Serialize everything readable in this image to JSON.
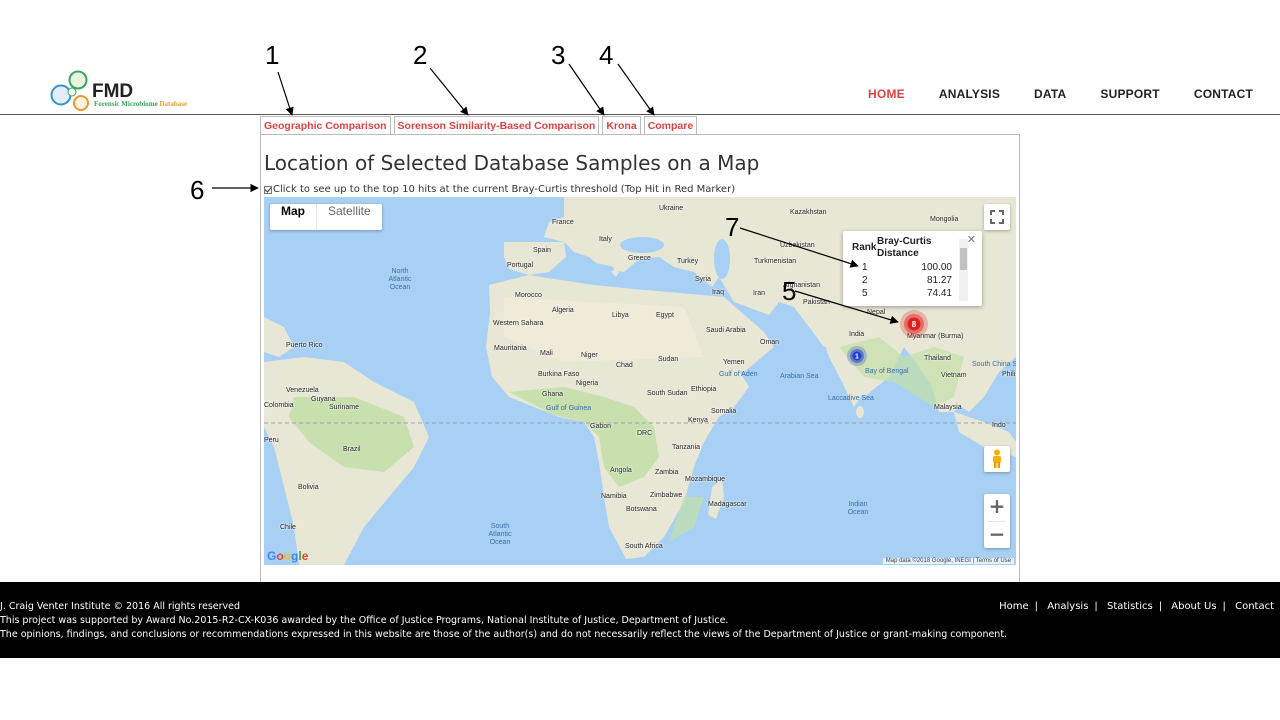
{
  "logo": {
    "title": "FMD",
    "subtitle_a": "Forensic Microbiome ",
    "subtitle_b": "Database"
  },
  "nav": [
    {
      "label": "HOME",
      "active": true
    },
    {
      "label": "ANALYSIS"
    },
    {
      "label": "DATA"
    },
    {
      "label": "SUPPORT"
    },
    {
      "label": "CONTACT"
    }
  ],
  "tabs": [
    "Geographic Comparison",
    "Sorenson Similarity-Based Comparison",
    "Krona",
    "Compare"
  ],
  "page_title": "Location of Selected Database Samples on a Map",
  "checkbox_label": "Click to see up to the top 10 hits at the current Bray-Curtis threshold (Top Hit in Red Marker)",
  "map": {
    "type_map": "Map",
    "type_satellite": "Satellite",
    "attribution": "Map data ©2018 Google, INEGI  |  Terms of Use",
    "labels": {
      "kazakhstan": "Kazakhstan",
      "mongolia": "Mongolia",
      "france": "France",
      "ukraine": "Ukraine",
      "spain": "Spain",
      "italy": "Italy",
      "portugal": "Portugal",
      "greece": "Greece",
      "turkey": "Turkey",
      "uzbekistan": "Uzbekistan",
      "turkmenistan": "Turkmenistan",
      "syria": "Syria",
      "iraq": "Iraq",
      "iran": "Iran",
      "afghanistan": "Afghanistan",
      "pakistan": "Pakistan",
      "nepal": "Nepal",
      "morocco": "Morocco",
      "algeria": "Algeria",
      "libya": "Libya",
      "egypt": "Egypt",
      "saudi": "Saudi Arabia",
      "oman": "Oman",
      "india": "India",
      "myanmar": "Myanmar (Burma)",
      "thailand": "Thailand",
      "vietnam": "Vietnam",
      "phili": "Phili",
      "scs": "South China Sea",
      "western_sahara": "Western Sahara",
      "mauritania": "Mauritania",
      "mali": "Mali",
      "niger": "Niger",
      "chad": "Chad",
      "sudan": "Sudan",
      "yemen": "Yemen",
      "gulf_aden": "Gulf of Aden",
      "arabian_sea": "Arabian Sea",
      "bay_bengal": "Bay of Bengal",
      "malaysia": "Malaysia",
      "burkina": "Burkina Faso",
      "nigeria": "Nigeria",
      "ghana": "Ghana",
      "south_sudan": "South Sudan",
      "ethiopia": "Ethiopia",
      "somalia": "Somalia",
      "gulf_guinea": "Gulf of Guinea",
      "gabon": "Gabon",
      "drc": "DRC",
      "kenya": "Kenya",
      "tanzania": "Tanzania",
      "laccadive": "Laccadive Sea",
      "puerto_rico": "Puerto Rico",
      "venezuela": "Venezuela",
      "colombia": "Colombia",
      "guyana": "Guyana",
      "suriname": "Suriname",
      "peru": "Peru",
      "brazil": "Brazil",
      "bolivia": "Bolivia",
      "chile": "Chile",
      "angola": "Angola",
      "zambia": "Zambia",
      "namibia": "Namibia",
      "zimbabwe": "Zimbabwe",
      "mozambique": "Mozambique",
      "botswana": "Botswana",
      "madagascar": "Madagascar",
      "south_africa": "South Africa",
      "indian_ocean": "Indian Ocean",
      "north_atlantic": "North Atlantic Ocean",
      "south_atlantic": "South Atlantic Ocean",
      "indonesia": "Indo"
    },
    "markers": [
      {
        "label": "8",
        "color": "#e02020"
      },
      {
        "label": "1",
        "color": "#2040d0"
      }
    ],
    "info": {
      "rank_header": "Rank",
      "distance_header": "Bray-Curtis Distance",
      "rows": [
        {
          "rank": "1",
          "value": "100.00"
        },
        {
          "rank": "2",
          "value": "81.27"
        },
        {
          "rank": "5",
          "value": "74.41"
        }
      ]
    }
  },
  "annotations": [
    "1",
    "2",
    "3",
    "4",
    "5",
    "6",
    "7"
  ],
  "footer": {
    "line1": "J. Craig Venter Institute © 2016 All rights reserved",
    "line2": "This project was supported by Award No.2015-R2-CX-K036 awarded by the Office of Justice Programs, National Institute of Justice, Department of Justice.",
    "line3": "The opinions, findings, and conclusions or recommendations expressed in this website are those of the author(s) and do not necessarily reflect the views of the Department of Justice or grant-making component.",
    "links": [
      "Home",
      "Analysis",
      "Statistics",
      "About Us",
      "Contact"
    ]
  },
  "colors": {
    "accent": "#e0433f",
    "ocean": "#a8d0f4",
    "land": "#e8e6d4",
    "green": "#c3dfa8"
  }
}
